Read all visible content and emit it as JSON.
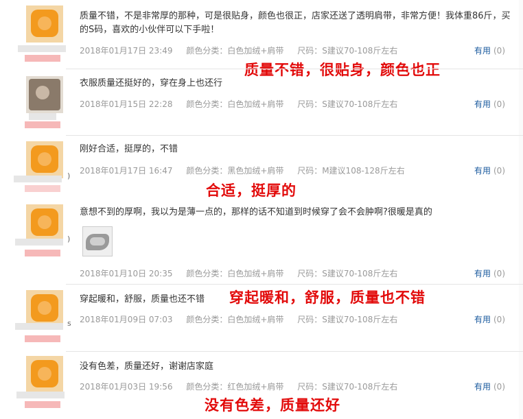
{
  "reviews": [
    {
      "nick_suffix": "",
      "content": "质量不错，不是非常厚的那种，可是很贴身，颜色也很正，店家还送了透明肩带，非常方便！我体重86斤，买的S码，喜欢的小伙伴可以下手啦！",
      "date": "2018年01月17日 23:49",
      "color": "颜色分类：白色加绒+肩带",
      "size": "尺码：S建议70-108斤左右",
      "useful_label": "有用",
      "useful_count": "(0)",
      "overlay": "质量不错，很贴身，颜色也正"
    },
    {
      "nick_suffix": "",
      "content": "衣服质量还挺好的，穿在身上也还行",
      "date": "2018年01月15日 22:28",
      "color": "颜色分类：白色加绒+肩带",
      "size": "尺码：S建议70-108斤左右",
      "useful_label": "有用",
      "useful_count": "(0)",
      "overlay": ""
    },
    {
      "nick_suffix": ")",
      "content": "刚好合适，挺厚的，不错",
      "date": "2018年01月17日 16:47",
      "color": "颜色分类：黑色加绒+肩带",
      "size": "尺码：M建议108-128斤左右",
      "useful_label": "有用",
      "useful_count": "(0)",
      "overlay": "合适，挺厚的"
    },
    {
      "nick_suffix": ")",
      "content": "意想不到的厚啊，我以为是薄一点的，那样的话不知道到时候穿了会不会肿啊?很暖是真的",
      "date": "2018年01月10日 20:35",
      "color": "颜色分类：白色加绒+肩带",
      "size": "尺码：S建议70-108斤左右",
      "useful_label": "有用",
      "useful_count": "(0)",
      "overlay": ""
    },
    {
      "nick_suffix": "s",
      "content": "穿起暖和，舒服，质量也还不错",
      "date": "2018年01月09日 07:03",
      "color": "颜色分类：白色加绒+肩带",
      "size": "尺码：S建议70-108斤左右",
      "useful_label": "有用",
      "useful_count": "(0)",
      "overlay": "穿起暖和，舒服，质量也不错"
    },
    {
      "nick_suffix": "",
      "content": "没有色差，质量还好，谢谢店家庭",
      "date": "2018年01月03日 19:56",
      "color": "颜色分类：红色加绒+肩带",
      "size": "尺码：S建议70-108斤左右",
      "useful_label": "有用",
      "useful_count": "(0)",
      "overlay": "没有色差，质量还好"
    }
  ],
  "colors": {
    "overlay": "#e20a0a",
    "link": "#1a5a9e",
    "meta": "#999999"
  },
  "icons": {
    "avatar": "avatar-icon",
    "photo": "review-photo"
  }
}
